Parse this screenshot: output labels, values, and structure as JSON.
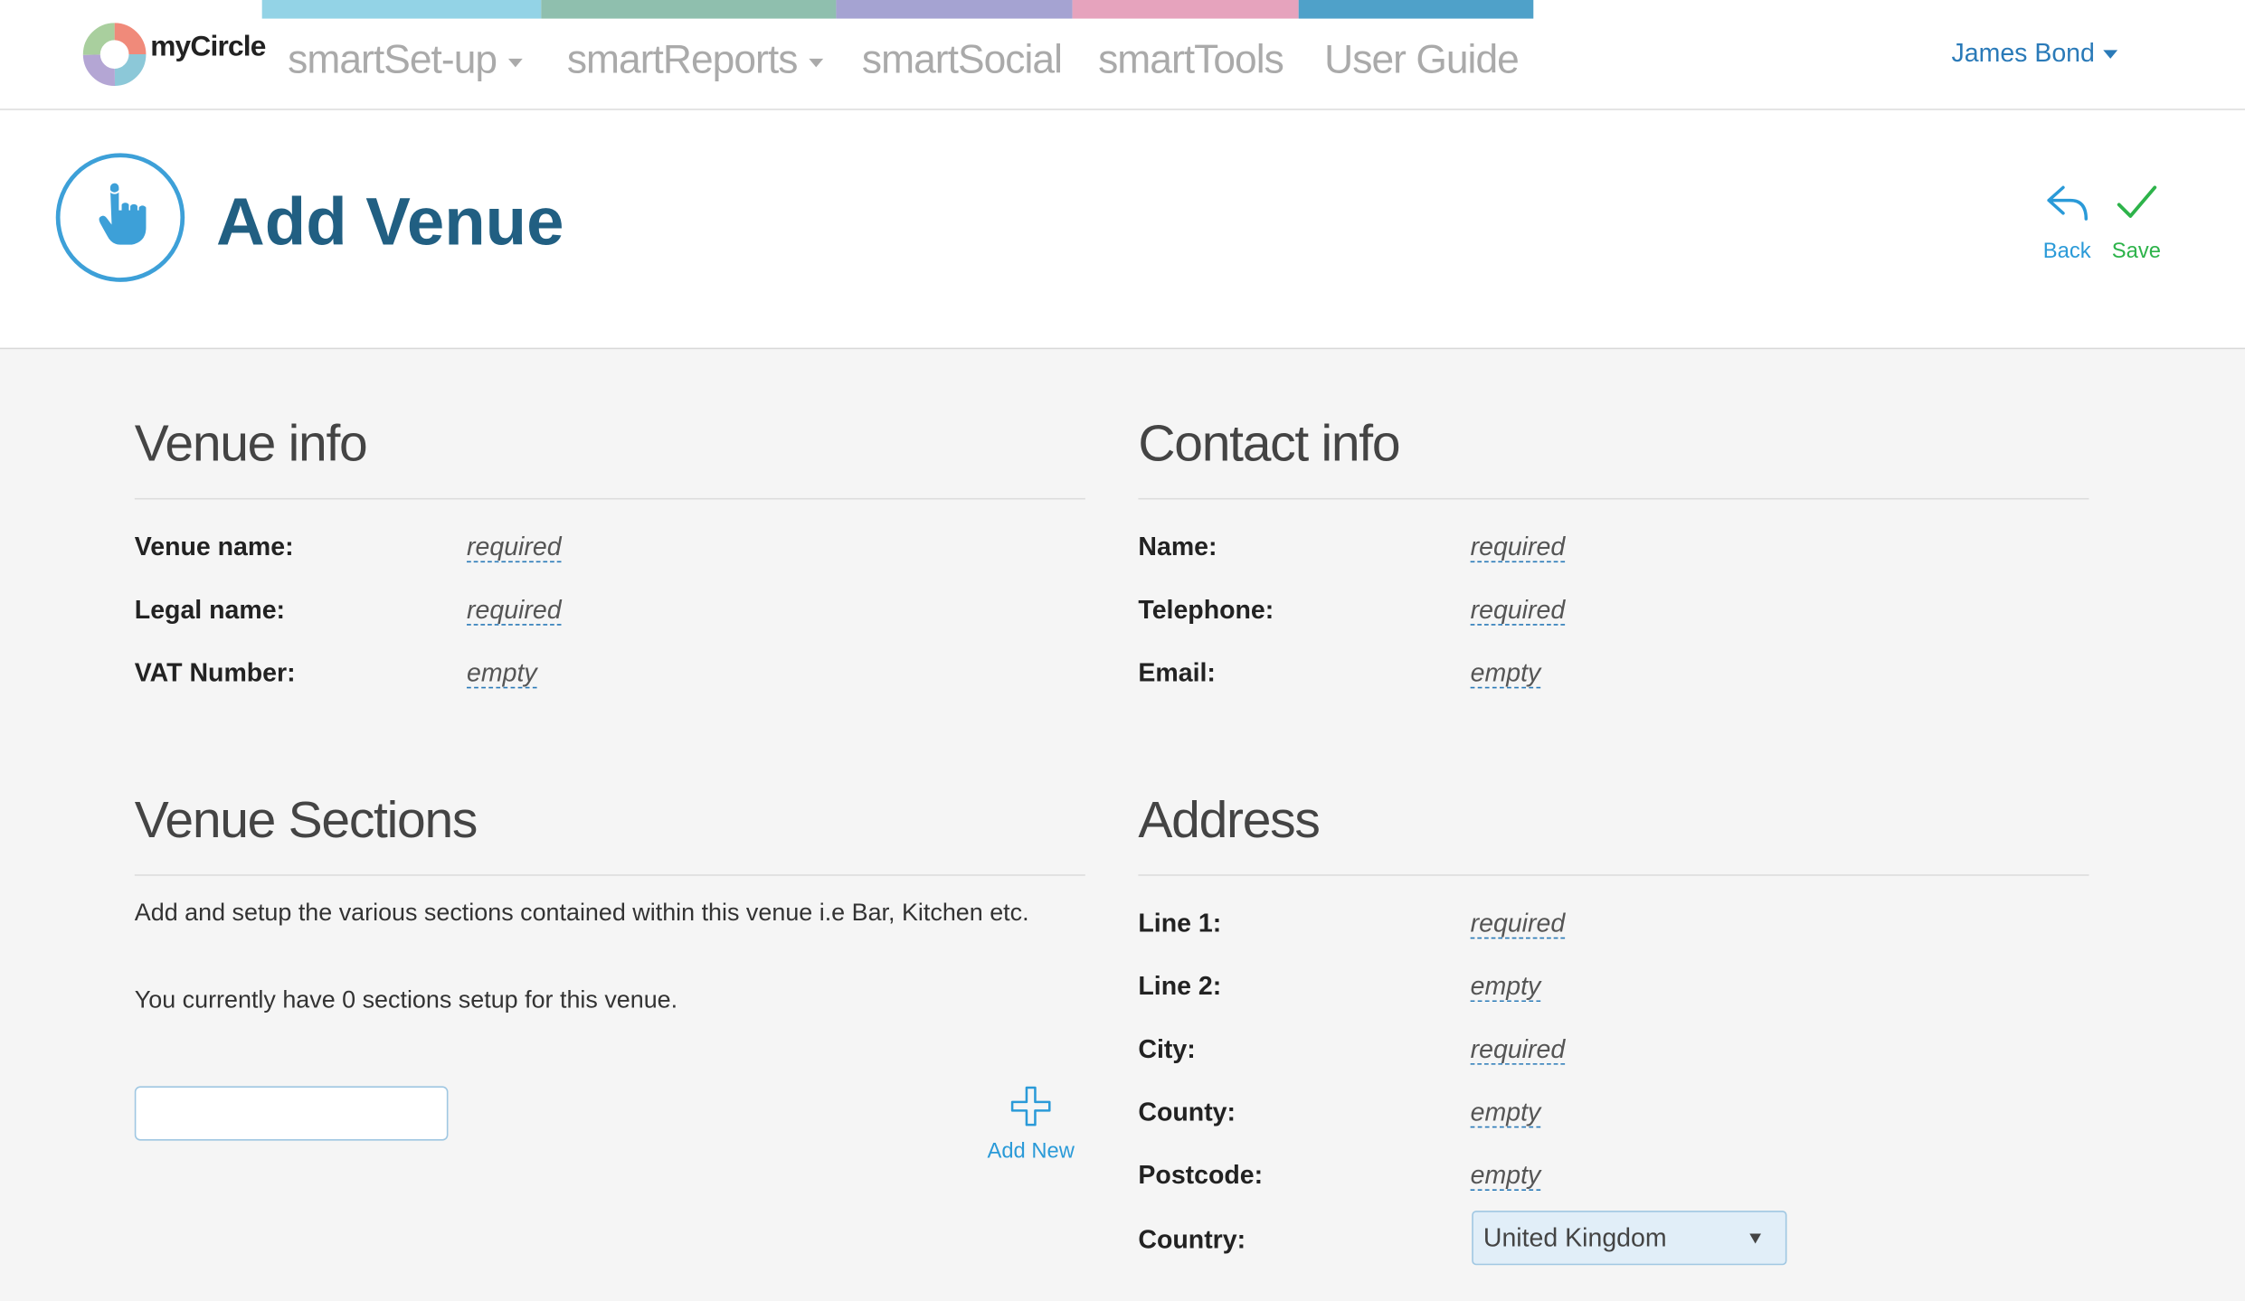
{
  "app": {
    "logo_text": "myCircle"
  },
  "nav": {
    "items": [
      {
        "label": "smartSet-up"
      },
      {
        "label": "smartReports"
      },
      {
        "label": "smartSocial"
      },
      {
        "label": "smartTools"
      },
      {
        "label": "User Guide"
      }
    ],
    "strip_colors": [
      "#93d3e6",
      "#8fbfae",
      "#a5a3d2",
      "#e6a3bd",
      "#4fa1c9"
    ],
    "user": "James Bond"
  },
  "header": {
    "title": "Add Venue",
    "icon": "pointing-hand-icon",
    "back_label": "Back",
    "save_label": "Save",
    "accent_color": "#215f82",
    "save_color": "#2db34a"
  },
  "venue_info": {
    "title": "Venue info",
    "fields": [
      {
        "label": "Venue name:",
        "value": "required"
      },
      {
        "label": "Legal name:",
        "value": "required"
      },
      {
        "label": "VAT Number:",
        "value": "empty"
      }
    ]
  },
  "contact_info": {
    "title": "Contact info",
    "fields": [
      {
        "label": "Name:",
        "value": "required"
      },
      {
        "label": "Telephone:",
        "value": "required"
      },
      {
        "label": "Email:",
        "value": "empty"
      }
    ]
  },
  "venue_sections": {
    "title": "Venue Sections",
    "description": "Add and setup the various sections contained within this venue i.e Bar, Kitchen etc.",
    "count_text": "You currently have 0 sections setup for this venue.",
    "input_value": "",
    "add_new_label": "Add New"
  },
  "address": {
    "title": "Address",
    "fields": [
      {
        "label": "Line 1:",
        "value": "required"
      },
      {
        "label": "Line 2:",
        "value": "empty"
      },
      {
        "label": "City:",
        "value": "required"
      },
      {
        "label": "County:",
        "value": "empty"
      },
      {
        "label": "Postcode:",
        "value": "empty"
      },
      {
        "label": "Country:",
        "value": "United Kingdom"
      }
    ]
  }
}
